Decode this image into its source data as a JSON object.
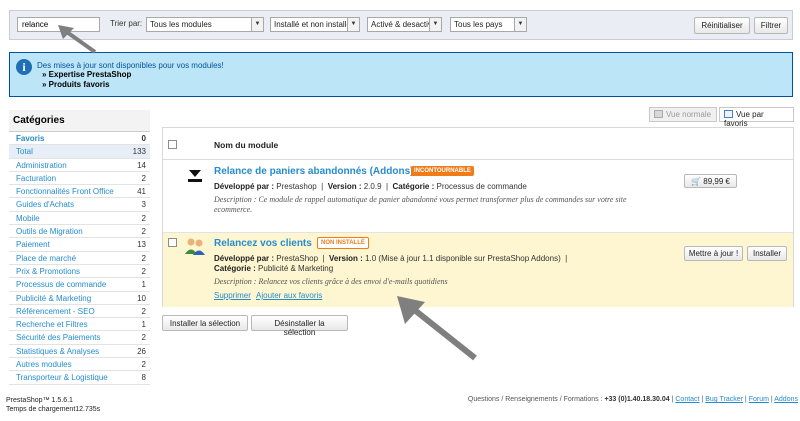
{
  "filters": {
    "search_value": "relance",
    "sort_label": "Trier par:",
    "modules_select": "Tous les modules",
    "install_select": "Installé et non installé",
    "active_select": "Activé & desactivé",
    "country_select": "Tous les pays",
    "reset_label": "Réinitialiser",
    "filter_label": "Filtrer"
  },
  "update_banner": {
    "message": "Des mises à jour sont disponibles pour vos modules!",
    "links": [
      "» Expertise PrestaShop",
      "» Produits favoris"
    ]
  },
  "categories": {
    "title": "Catégories",
    "items": [
      {
        "label": "Favoris",
        "count": "0"
      },
      {
        "label": "Total",
        "count": "133"
      },
      {
        "label": "Administration",
        "count": "14"
      },
      {
        "label": "Facturation",
        "count": "2"
      },
      {
        "label": "Fonctionnalités Front Office",
        "count": "41"
      },
      {
        "label": "Guides d'Achats",
        "count": "3"
      },
      {
        "label": "Mobile",
        "count": "2"
      },
      {
        "label": "Outils de Migration",
        "count": "2"
      },
      {
        "label": "Paiement",
        "count": "13"
      },
      {
        "label": "Place de marché",
        "count": "2"
      },
      {
        "label": "Prix & Promotions",
        "count": "2"
      },
      {
        "label": "Processus de commande",
        "count": "1"
      },
      {
        "label": "Publicité & Marketing",
        "count": "10"
      },
      {
        "label": "Référencement - SEO",
        "count": "2"
      },
      {
        "label": "Recherche et Filtres",
        "count": "1"
      },
      {
        "label": "Sécurité des Paiements",
        "count": "2"
      },
      {
        "label": "Statistiques & Analyses",
        "count": "26"
      },
      {
        "label": "Autres modules",
        "count": "2"
      },
      {
        "label": "Transporteur & Logistique",
        "count": "8"
      }
    ]
  },
  "view": {
    "normal_label": "Vue normale",
    "favorites_label": "Vue par favoris"
  },
  "table": {
    "header_label": "Nom du module"
  },
  "modules": [
    {
      "title": "Relance de paniers abandonnés (Addons)",
      "badge": "INCONTOURNABLE",
      "dev_label": "Développé par :",
      "developer": "Prestashop",
      "version_label": "Version :",
      "version": "2.0.9",
      "category_label": "Catégorie :",
      "category": "Processus de commande",
      "description": "Description : Ce module de rappel automatique de panier abandonné vous permet transformer plus de commandes sur votre site ecommerce.",
      "price": "89,99 €"
    },
    {
      "title": "Relancez vos clients",
      "badge": "NON INSTALLÉ",
      "dev_label": "Développé par :",
      "developer": "PrestaShop",
      "version_label": "Version :",
      "version": "1.0 (Mise à jour 1.1 disponible sur PrestaShop Addons)",
      "category_label": "Catégorie :",
      "category": "Publicité & Marketing",
      "description": "Description : Relancez vos clients grâce à des envoi d'e-mails quotidiens",
      "delete_link": "Supprimer",
      "favorite_link": "Ajouter aux favoris",
      "update_button": "Mettre à jour !",
      "install_button": "Installer"
    }
  ],
  "bulk": {
    "install_selection": "Installer la sélection",
    "uninstall_selection": "Désinstaller la sélection"
  },
  "footer": {
    "version": "PrestaShop™ 1.5.6.1",
    "load_time": "Temps de chargement12.735s",
    "contact_text": "Questions / Renseignements / Formations :",
    "phone": "+33 (0)1.40.18.30.04",
    "links": [
      "Contact",
      "Bug Tracker",
      "Forum",
      "Addons"
    ]
  }
}
